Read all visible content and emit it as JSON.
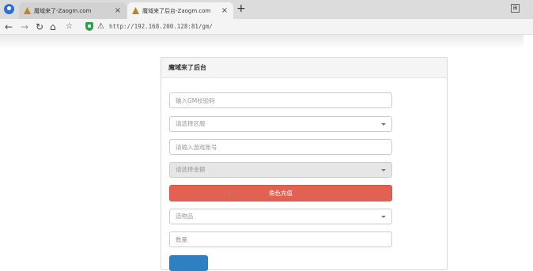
{
  "browser": {
    "tabs": [
      {
        "title": "魔域来了-Zaogm.com",
        "active": false
      },
      {
        "title": "魔域来了后台-Zaogm.com",
        "active": true
      }
    ],
    "new_tab_label": "+",
    "address": "http://192.168.200.128:81/gm/"
  },
  "panel": {
    "title": "魔域来了后台",
    "gm_code_placeholder": "输入GM校验码",
    "server_select": "请选择区服",
    "account_placeholder": "请输入游戏账号",
    "amount_select": "请选择金额",
    "recharge_button": "角色充值",
    "item_select": "选物品",
    "quantity_placeholder": "数量"
  },
  "colors": {
    "recharge_button": "#e36152",
    "bottom_button": "#2f7fc1",
    "shield": "#2aa24a"
  }
}
